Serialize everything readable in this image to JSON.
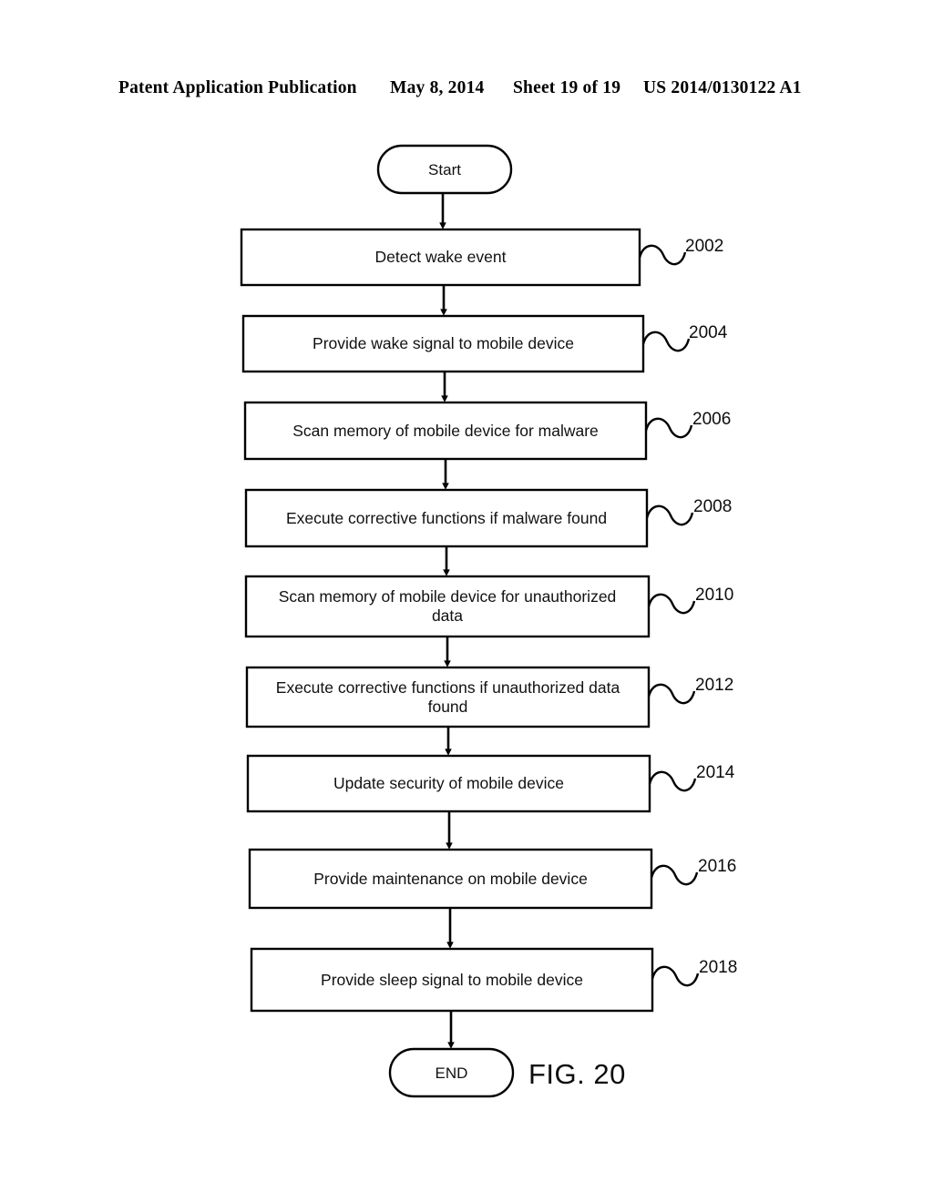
{
  "header": {
    "publication": "Patent Application Publication",
    "date": "May 8, 2014",
    "sheet": "Sheet 19 of 19",
    "number": "US 2014/0130122 A1"
  },
  "figure": {
    "label": "FIG. 20",
    "start_label": "Start",
    "end_label": "END"
  },
  "flowchart": {
    "steps": [
      {
        "ref": "2002",
        "text": "Detect wake event"
      },
      {
        "ref": "2004",
        "text": "Provide wake signal to mobile device"
      },
      {
        "ref": "2006",
        "text": "Scan memory of mobile device for malware"
      },
      {
        "ref": "2008",
        "text": "Execute corrective functions if malware found"
      },
      {
        "ref": "2010",
        "text": "Scan memory of mobile device for unauthorized\ndata"
      },
      {
        "ref": "2012",
        "text": "Execute corrective functions if unauthorized data\nfound"
      },
      {
        "ref": "2014",
        "text": "Update security of mobile device"
      },
      {
        "ref": "2016",
        "text": "Provide maintenance on mobile device"
      },
      {
        "ref": "2018",
        "text": "Provide sleep signal to mobile device"
      }
    ]
  },
  "colors": {
    "ink": "#000000",
    "page": "#ffffff"
  }
}
